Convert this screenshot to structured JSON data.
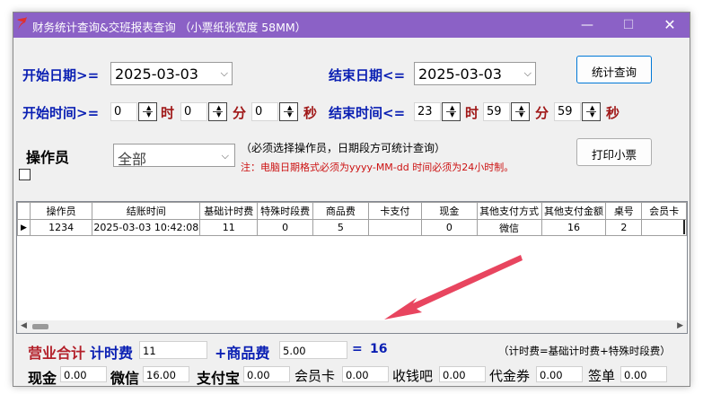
{
  "window": {
    "title": "财务统计查询&交班报表查询 （小票纸张宽度 58MM）",
    "controls": {
      "minimize": "—",
      "maximize": "☐",
      "close": "✕"
    }
  },
  "filters": {
    "start_date_label": "开始日期>=",
    "start_date_value": "2025-03-03",
    "end_date_label": "结束日期<=",
    "end_date_value": "2025-03-03",
    "start_time_label": "开始时间>=",
    "end_time_label": "结束时间<=",
    "start_time": {
      "hour": "0",
      "minute": "0",
      "second": "0"
    },
    "end_time": {
      "hour": "23",
      "minute": "59",
      "second": "59"
    },
    "unit_hour": "时",
    "unit_minute": "分",
    "unit_second": "秒",
    "operator_label": "操作员",
    "operator_value": "全部",
    "note_operator": "（必须选择操作员，日期段方可统计查询）",
    "note_format": "注：电脑日期格式必须为yyyy-MM-dd 时间必须为24小时制。"
  },
  "buttons": {
    "query": "统计查询",
    "print": "打印小票"
  },
  "grid": {
    "columns": [
      "操作员",
      "结账时间",
      "基础计时费",
      "特殊时段费",
      "商品费",
      "卡支付",
      "现金",
      "其他支付方式",
      "其他支付金额",
      "桌号",
      "会员卡"
    ],
    "rows": [
      [
        "1234",
        "2025-03-03 10:42:08",
        "11",
        "0",
        "5",
        "",
        "0",
        "微信",
        "16",
        "2",
        ""
      ]
    ],
    "row_marker": "▶"
  },
  "summary": {
    "total_label": "营业合计",
    "timing_label": "计时费",
    "timing_value": "11",
    "goods_label": "+商品费",
    "goods_value": "5.00",
    "equals": "=",
    "total_value": "16",
    "formula_note": "（计时费=基础计时费+特殊时段费）"
  },
  "payments": [
    {
      "label": "现金",
      "value": "0.00",
      "bold": true
    },
    {
      "label": "微信",
      "value": "16.00",
      "bold": true
    },
    {
      "label": "支付宝",
      "value": "0.00",
      "bold": true
    },
    {
      "label": "会员卡",
      "value": "0.00",
      "bold": false
    },
    {
      "label": "收钱吧",
      "value": "0.00",
      "bold": false
    },
    {
      "label": "代金券",
      "value": "0.00",
      "bold": false
    },
    {
      "label": "签单",
      "value": "0.00",
      "bold": false
    }
  ],
  "colors": {
    "titlebar": "#8b61c6",
    "label_blue": "#0a1fb3",
    "label_red": "#a01818",
    "annotation_arrow": "#e8455f"
  }
}
